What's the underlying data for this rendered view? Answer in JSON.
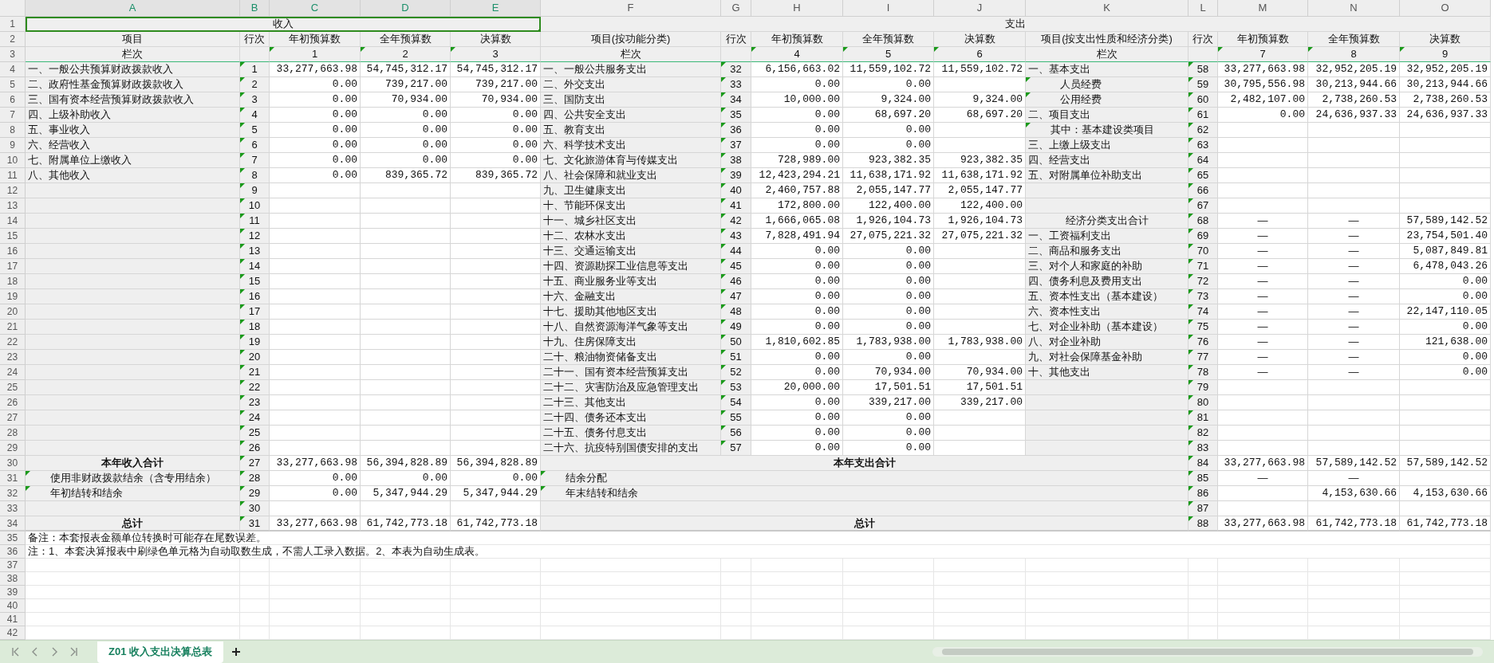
{
  "columns": [
    {
      "letter": "A",
      "selected": true
    },
    {
      "letter": "B",
      "selected": true
    },
    {
      "letter": "C",
      "selected": true
    },
    {
      "letter": "D",
      "selected": true
    },
    {
      "letter": "E",
      "selected": true
    },
    {
      "letter": "F",
      "selected": false
    },
    {
      "letter": "G",
      "selected": false
    },
    {
      "letter": "H",
      "selected": false
    },
    {
      "letter": "I",
      "selected": false
    },
    {
      "letter": "J",
      "selected": false
    },
    {
      "letter": "K",
      "selected": false
    },
    {
      "letter": "L",
      "selected": false
    },
    {
      "letter": "M",
      "selected": false
    },
    {
      "letter": "N",
      "selected": false
    },
    {
      "letter": "O",
      "selected": false
    }
  ],
  "rows": [
    {
      "number": "1",
      "kind": "title",
      "income": {
        "text": "收入",
        "selected": true
      },
      "expense": {
        "text": "支出",
        "selected": false
      }
    },
    {
      "number": "2",
      "kind": "header",
      "income": {
        "kind": "center",
        "cells": [
          "项目",
          "行次",
          "年初预算数",
          "全年预算数",
          "决算数"
        ],
        "flags": [
          false,
          false,
          false,
          false,
          false
        ]
      },
      "function": {
        "kind": "center",
        "cells": [
          "项目(按功能分类)",
          "行次",
          "年初预算数",
          "全年预算数",
          "决算数"
        ],
        "flags": [
          false,
          false,
          false,
          false,
          false
        ]
      },
      "economic": {
        "kind": "center",
        "cells": [
          "项目(按支出性质和经济分类)",
          "行次",
          "年初预算数",
          "全年预算数",
          "决算数"
        ],
        "flags": [
          false,
          false,
          false,
          false,
          false
        ]
      }
    },
    {
      "number": "3",
      "kind": "header",
      "income": {
        "kind": "center",
        "cells": [
          "栏次",
          null,
          "1",
          "2",
          "3"
        ],
        "flags": [
          false,
          false,
          true,
          true,
          true
        ]
      },
      "function": {
        "kind": "center",
        "cells": [
          "栏次",
          null,
          "4",
          "5",
          "6"
        ],
        "flags": [
          false,
          false,
          true,
          true,
          true
        ]
      },
      "economic": {
        "kind": "center",
        "cells": [
          "栏次",
          null,
          "7",
          "8",
          "9"
        ],
        "flags": [
          false,
          false,
          true,
          true,
          true
        ]
      }
    },
    {
      "number": "4",
      "kind": "body",
      "income": {
        "kind": "plain",
        "cells": [
          "一、一般公共预算财政拨款收入",
          "1",
          "33,277,663.98",
          "54,745,312.17",
          "54,745,312.17"
        ],
        "flags": [
          false,
          true,
          false,
          false,
          false
        ]
      },
      "function": {
        "kind": "plain",
        "cells": [
          "一、一般公共服务支出",
          "32",
          "6,156,663.02",
          "11,559,102.72",
          "11,559,102.72"
        ],
        "flags": [
          false,
          true,
          false,
          false,
          false
        ]
      },
      "economic": {
        "kind": "plain",
        "cells": [
          "一、基本支出",
          "58",
          "33,277,663.98",
          "32,952,205.19",
          "32,952,205.19"
        ],
        "flags": [
          false,
          true,
          false,
          false,
          false
        ]
      }
    },
    {
      "number": "5",
      "kind": "body",
      "income": {
        "kind": "plain",
        "cells": [
          "二、政府性基金预算财政拨款收入",
          "2",
          "0.00",
          "739,217.00",
          "739,217.00"
        ],
        "flags": [
          false,
          true,
          false,
          false,
          false
        ]
      },
      "function": {
        "kind": "plain",
        "cells": [
          "二、外交支出",
          "33",
          "0.00",
          "0.00",
          null
        ],
        "flags": [
          false,
          true,
          false,
          false,
          false
        ]
      },
      "economic": {
        "kind": "deep_indent",
        "cells": [
          "人员经费",
          "59",
          "30,795,556.98",
          "30,213,944.66",
          "30,213,944.66"
        ],
        "flags": [
          true,
          true,
          false,
          false,
          false
        ]
      }
    },
    {
      "number": "6",
      "kind": "body",
      "income": {
        "kind": "plain",
        "cells": [
          "三、国有资本经营预算财政拨款收入",
          "3",
          "0.00",
          "70,934.00",
          "70,934.00"
        ],
        "flags": [
          false,
          true,
          false,
          false,
          false
        ]
      },
      "function": {
        "kind": "plain",
        "cells": [
          "三、国防支出",
          "34",
          "10,000.00",
          "9,324.00",
          "9,324.00"
        ],
        "flags": [
          false,
          true,
          false,
          false,
          false
        ]
      },
      "economic": {
        "kind": "deep_indent",
        "cells": [
          "公用经费",
          "60",
          "2,482,107.00",
          "2,738,260.53",
          "2,738,260.53"
        ],
        "flags": [
          true,
          true,
          false,
          false,
          false
        ]
      }
    },
    {
      "number": "7",
      "kind": "body",
      "income": {
        "kind": "plain",
        "cells": [
          "四、上级补助收入",
          "4",
          "0.00",
          "0.00",
          "0.00"
        ],
        "flags": [
          false,
          true,
          false,
          false,
          false
        ]
      },
      "function": {
        "kind": "plain",
        "cells": [
          "四、公共安全支出",
          "35",
          "0.00",
          "68,697.20",
          "68,697.20"
        ],
        "flags": [
          false,
          true,
          false,
          false,
          false
        ]
      },
      "economic": {
        "kind": "plain",
        "cells": [
          "二、项目支出",
          "61",
          "0.00",
          "24,636,937.33",
          "24,636,937.33"
        ],
        "flags": [
          false,
          true,
          false,
          false,
          false
        ]
      }
    },
    {
      "number": "8",
      "kind": "body",
      "income": {
        "kind": "plain",
        "cells": [
          "五、事业收入",
          "5",
          "0.00",
          "0.00",
          "0.00"
        ],
        "flags": [
          false,
          true,
          false,
          false,
          false
        ]
      },
      "function": {
        "kind": "plain",
        "cells": [
          "五、教育支出",
          "36",
          "0.00",
          "0.00",
          null
        ],
        "flags": [
          false,
          true,
          false,
          false,
          false
        ]
      },
      "economic": {
        "kind": "indent",
        "cells": [
          "其中：基本建设类项目",
          "62",
          null,
          null,
          null
        ],
        "flags": [
          true,
          true,
          false,
          false,
          false
        ]
      }
    },
    {
      "number": "9",
      "kind": "body",
      "income": {
        "kind": "plain",
        "cells": [
          "六、经营收入",
          "6",
          "0.00",
          "0.00",
          "0.00"
        ],
        "flags": [
          false,
          true,
          false,
          false,
          false
        ]
      },
      "function": {
        "kind": "plain",
        "cells": [
          "六、科学技术支出",
          "37",
          "0.00",
          "0.00",
          null
        ],
        "flags": [
          false,
          true,
          false,
          false,
          false
        ]
      },
      "economic": {
        "kind": "plain",
        "cells": [
          "三、上缴上级支出",
          "63",
          null,
          null,
          null
        ],
        "flags": [
          false,
          true,
          false,
          false,
          false
        ]
      }
    },
    {
      "number": "10",
      "kind": "body",
      "income": {
        "kind": "plain",
        "cells": [
          "七、附属单位上缴收入",
          "7",
          "0.00",
          "0.00",
          "0.00"
        ],
        "flags": [
          false,
          true,
          false,
          false,
          false
        ]
      },
      "function": {
        "kind": "plain",
        "cells": [
          "七、文化旅游体育与传媒支出",
          "38",
          "728,989.00",
          "923,382.35",
          "923,382.35"
        ],
        "flags": [
          false,
          true,
          false,
          false,
          false
        ]
      },
      "economic": {
        "kind": "plain",
        "cells": [
          "四、经营支出",
          "64",
          null,
          null,
          null
        ],
        "flags": [
          false,
          true,
          false,
          false,
          false
        ]
      }
    },
    {
      "number": "11",
      "kind": "body",
      "income": {
        "kind": "plain",
        "cells": [
          "八、其他收入",
          "8",
          "0.00",
          "839,365.72",
          "839,365.72"
        ],
        "flags": [
          false,
          true,
          false,
          false,
          false
        ]
      },
      "function": {
        "kind": "plain",
        "cells": [
          "八、社会保障和就业支出",
          "39",
          "12,423,294.21",
          "11,638,171.92",
          "11,638,171.92"
        ],
        "flags": [
          false,
          true,
          false,
          false,
          false
        ]
      },
      "economic": {
        "kind": "plain",
        "cells": [
          "五、对附属单位补助支出",
          "65",
          null,
          null,
          null
        ],
        "flags": [
          false,
          true,
          false,
          false,
          false
        ]
      }
    },
    {
      "number": "12",
      "kind": "body",
      "income": {
        "kind": "plain",
        "cells": [
          null,
          "9",
          null,
          null,
          null
        ],
        "flags": [
          false,
          true,
          false,
          false,
          false
        ]
      },
      "function": {
        "kind": "plain",
        "cells": [
          "九、卫生健康支出",
          "40",
          "2,460,757.88",
          "2,055,147.77",
          "2,055,147.77"
        ],
        "flags": [
          false,
          true,
          false,
          false,
          false
        ]
      },
      "economic": {
        "kind": "plain",
        "cells": [
          null,
          "66",
          null,
          null,
          null
        ],
        "flags": [
          false,
          true,
          false,
          false,
          false
        ]
      }
    },
    {
      "number": "13",
      "kind": "body",
      "income": {
        "kind": "plain",
        "cells": [
          null,
          "10",
          null,
          null,
          null
        ],
        "flags": [
          false,
          true,
          false,
          false,
          false
        ]
      },
      "function": {
        "kind": "plain",
        "cells": [
          "十、节能环保支出",
          "41",
          "172,800.00",
          "122,400.00",
          "122,400.00"
        ],
        "flags": [
          false,
          true,
          false,
          false,
          false
        ]
      },
      "economic": {
        "kind": "plain",
        "cells": [
          null,
          "67",
          null,
          null,
          null
        ],
        "flags": [
          false,
          true,
          false,
          false,
          false
        ]
      }
    },
    {
      "number": "14",
      "kind": "body",
      "income": {
        "kind": "plain",
        "cells": [
          null,
          "11",
          null,
          null,
          null
        ],
        "flags": [
          false,
          true,
          false,
          false,
          false
        ]
      },
      "function": {
        "kind": "plain",
        "cells": [
          "十一、城乡社区支出",
          "42",
          "1,666,065.08",
          "1,926,104.73",
          "1,926,104.73"
        ],
        "flags": [
          false,
          true,
          false,
          false,
          false
        ]
      },
      "economic": {
        "kind": "center",
        "cells": [
          "经济分类支出合计",
          "68",
          "—",
          "—",
          "57,589,142.52"
        ],
        "flags": [
          false,
          true,
          false,
          false,
          false
        ],
        "not_applicable": [
          true,
          true,
          false
        ]
      }
    },
    {
      "number": "15",
      "kind": "body",
      "income": {
        "kind": "plain",
        "cells": [
          null,
          "12",
          null,
          null,
          null
        ],
        "flags": [
          false,
          true,
          false,
          false,
          false
        ]
      },
      "function": {
        "kind": "plain",
        "cells": [
          "十二、农林水支出",
          "43",
          "7,828,491.94",
          "27,075,221.32",
          "27,075,221.32"
        ],
        "flags": [
          false,
          true,
          false,
          false,
          false
        ]
      },
      "economic": {
        "kind": "plain",
        "cells": [
          "一、工资福利支出",
          "69",
          "—",
          "—",
          "23,754,501.40"
        ],
        "flags": [
          false,
          true,
          false,
          false,
          false
        ],
        "not_applicable": [
          true,
          true,
          false
        ]
      }
    },
    {
      "number": "16",
      "kind": "body",
      "income": {
        "kind": "plain",
        "cells": [
          null,
          "13",
          null,
          null,
          null
        ],
        "flags": [
          false,
          true,
          false,
          false,
          false
        ]
      },
      "function": {
        "kind": "plain",
        "cells": [
          "十三、交通运输支出",
          "44",
          "0.00",
          "0.00",
          null
        ],
        "flags": [
          false,
          true,
          false,
          false,
          false
        ]
      },
      "economic": {
        "kind": "plain",
        "cells": [
          "二、商品和服务支出",
          "70",
          "—",
          "—",
          "5,087,849.81"
        ],
        "flags": [
          false,
          true,
          false,
          false,
          false
        ],
        "not_applicable": [
          true,
          true,
          false
        ]
      }
    },
    {
      "number": "17",
      "kind": "body",
      "income": {
        "kind": "plain",
        "cells": [
          null,
          "14",
          null,
          null,
          null
        ],
        "flags": [
          false,
          true,
          false,
          false,
          false
        ]
      },
      "function": {
        "kind": "plain",
        "cells": [
          "十四、资源勘探工业信息等支出",
          "45",
          "0.00",
          "0.00",
          null
        ],
        "flags": [
          false,
          true,
          false,
          false,
          false
        ]
      },
      "economic": {
        "kind": "plain",
        "cells": [
          "三、对个人和家庭的补助",
          "71",
          "—",
          "—",
          "6,478,043.26"
        ],
        "flags": [
          false,
          true,
          false,
          false,
          false
        ],
        "not_applicable": [
          true,
          true,
          false
        ]
      }
    },
    {
      "number": "18",
      "kind": "body",
      "income": {
        "kind": "plain",
        "cells": [
          null,
          "15",
          null,
          null,
          null
        ],
        "flags": [
          false,
          true,
          false,
          false,
          false
        ]
      },
      "function": {
        "kind": "plain",
        "cells": [
          "十五、商业服务业等支出",
          "46",
          "0.00",
          "0.00",
          null
        ],
        "flags": [
          false,
          true,
          false,
          false,
          false
        ]
      },
      "economic": {
        "kind": "plain",
        "cells": [
          "四、债务利息及费用支出",
          "72",
          "—",
          "—",
          "0.00"
        ],
        "flags": [
          false,
          true,
          false,
          false,
          false
        ],
        "not_applicable": [
          true,
          true,
          false
        ]
      }
    },
    {
      "number": "19",
      "kind": "body",
      "income": {
        "kind": "plain",
        "cells": [
          null,
          "16",
          null,
          null,
          null
        ],
        "flags": [
          false,
          true,
          false,
          false,
          false
        ]
      },
      "function": {
        "kind": "plain",
        "cells": [
          "十六、金融支出",
          "47",
          "0.00",
          "0.00",
          null
        ],
        "flags": [
          false,
          true,
          false,
          false,
          false
        ]
      },
      "economic": {
        "kind": "plain",
        "cells": [
          "五、资本性支出（基本建设）",
          "73",
          "—",
          "—",
          "0.00"
        ],
        "flags": [
          false,
          true,
          false,
          false,
          false
        ],
        "not_applicable": [
          true,
          true,
          false
        ]
      }
    },
    {
      "number": "20",
      "kind": "body",
      "income": {
        "kind": "plain",
        "cells": [
          null,
          "17",
          null,
          null,
          null
        ],
        "flags": [
          false,
          true,
          false,
          false,
          false
        ]
      },
      "function": {
        "kind": "plain",
        "cells": [
          "十七、援助其他地区支出",
          "48",
          "0.00",
          "0.00",
          null
        ],
        "flags": [
          false,
          true,
          false,
          false,
          false
        ]
      },
      "economic": {
        "kind": "plain",
        "cells": [
          "六、资本性支出",
          "74",
          "—",
          "—",
          "22,147,110.05"
        ],
        "flags": [
          false,
          true,
          false,
          false,
          false
        ],
        "not_applicable": [
          true,
          true,
          false
        ]
      }
    },
    {
      "number": "21",
      "kind": "body",
      "income": {
        "kind": "plain",
        "cells": [
          null,
          "18",
          null,
          null,
          null
        ],
        "flags": [
          false,
          true,
          false,
          false,
          false
        ]
      },
      "function": {
        "kind": "plain",
        "cells": [
          "十八、自然资源海洋气象等支出",
          "49",
          "0.00",
          "0.00",
          null
        ],
        "flags": [
          false,
          true,
          false,
          false,
          false
        ]
      },
      "economic": {
        "kind": "plain",
        "cells": [
          "七、对企业补助（基本建设）",
          "75",
          "—",
          "—",
          "0.00"
        ],
        "flags": [
          false,
          true,
          false,
          false,
          false
        ],
        "not_applicable": [
          true,
          true,
          false
        ]
      }
    },
    {
      "number": "22",
      "kind": "body",
      "income": {
        "kind": "plain",
        "cells": [
          null,
          "19",
          null,
          null,
          null
        ],
        "flags": [
          false,
          true,
          false,
          false,
          false
        ]
      },
      "function": {
        "kind": "plain",
        "cells": [
          "十九、住房保障支出",
          "50",
          "1,810,602.85",
          "1,783,938.00",
          "1,783,938.00"
        ],
        "flags": [
          false,
          true,
          false,
          false,
          false
        ]
      },
      "economic": {
        "kind": "plain",
        "cells": [
          "八、对企业补助",
          "76",
          "—",
          "—",
          "121,638.00"
        ],
        "flags": [
          false,
          true,
          false,
          false,
          false
        ],
        "not_applicable": [
          true,
          true,
          false
        ]
      }
    },
    {
      "number": "23",
      "kind": "body",
      "income": {
        "kind": "plain",
        "cells": [
          null,
          "20",
          null,
          null,
          null
        ],
        "flags": [
          false,
          true,
          false,
          false,
          false
        ]
      },
      "function": {
        "kind": "plain",
        "cells": [
          "二十、粮油物资储备支出",
          "51",
          "0.00",
          "0.00",
          null
        ],
        "flags": [
          false,
          true,
          false,
          false,
          false
        ]
      },
      "economic": {
        "kind": "plain",
        "cells": [
          "九、对社会保障基金补助",
          "77",
          "—",
          "—",
          "0.00"
        ],
        "flags": [
          false,
          true,
          false,
          false,
          false
        ],
        "not_applicable": [
          true,
          true,
          false
        ]
      }
    },
    {
      "number": "24",
      "kind": "body",
      "income": {
        "kind": "plain",
        "cells": [
          null,
          "21",
          null,
          null,
          null
        ],
        "flags": [
          false,
          true,
          false,
          false,
          false
        ]
      },
      "function": {
        "kind": "plain",
        "cells": [
          "二十一、国有资本经营预算支出",
          "52",
          "0.00",
          "70,934.00",
          "70,934.00"
        ],
        "flags": [
          false,
          true,
          false,
          false,
          false
        ]
      },
      "economic": {
        "kind": "plain",
        "cells": [
          "十、其他支出",
          "78",
          "—",
          "—",
          "0.00"
        ],
        "flags": [
          false,
          true,
          false,
          false,
          false
        ],
        "not_applicable": [
          true,
          true,
          false
        ]
      }
    },
    {
      "number": "25",
      "kind": "body",
      "income": {
        "kind": "plain",
        "cells": [
          null,
          "22",
          null,
          null,
          null
        ],
        "flags": [
          false,
          true,
          false,
          false,
          false
        ]
      },
      "function": {
        "kind": "plain",
        "cells": [
          "二十二、灾害防治及应急管理支出",
          "53",
          "20,000.00",
          "17,501.51",
          "17,501.51"
        ],
        "flags": [
          false,
          true,
          false,
          false,
          false
        ]
      },
      "economic": {
        "kind": "plain",
        "cells": [
          null,
          "79",
          null,
          null,
          null
        ],
        "flags": [
          false,
          true,
          false,
          false,
          false
        ]
      }
    },
    {
      "number": "26",
      "kind": "body",
      "income": {
        "kind": "plain",
        "cells": [
          null,
          "23",
          null,
          null,
          null
        ],
        "flags": [
          false,
          true,
          false,
          false,
          false
        ]
      },
      "function": {
        "kind": "plain",
        "cells": [
          "二十三、其他支出",
          "54",
          "0.00",
          "339,217.00",
          "339,217.00"
        ],
        "flags": [
          false,
          true,
          false,
          false,
          false
        ]
      },
      "economic": {
        "kind": "plain",
        "cells": [
          null,
          "80",
          null,
          null,
          null
        ],
        "flags": [
          false,
          true,
          false,
          false,
          false
        ]
      }
    },
    {
      "number": "27",
      "kind": "body",
      "income": {
        "kind": "plain",
        "cells": [
          null,
          "24",
          null,
          null,
          null
        ],
        "flags": [
          false,
          true,
          false,
          false,
          false
        ]
      },
      "function": {
        "kind": "plain",
        "cells": [
          "二十四、债务还本支出",
          "55",
          "0.00",
          "0.00",
          null
        ],
        "flags": [
          false,
          true,
          false,
          false,
          false
        ]
      },
      "economic": {
        "kind": "plain",
        "cells": [
          null,
          "81",
          null,
          null,
          null
        ],
        "flags": [
          false,
          true,
          false,
          false,
          false
        ]
      }
    },
    {
      "number": "28",
      "kind": "body",
      "income": {
        "kind": "plain",
        "cells": [
          null,
          "25",
          null,
          null,
          null
        ],
        "flags": [
          false,
          true,
          false,
          false,
          false
        ]
      },
      "function": {
        "kind": "plain",
        "cells": [
          "二十五、债务付息支出",
          "56",
          "0.00",
          "0.00",
          null
        ],
        "flags": [
          false,
          true,
          false,
          false,
          false
        ]
      },
      "economic": {
        "kind": "plain",
        "cells": [
          null,
          "82",
          null,
          null,
          null
        ],
        "flags": [
          false,
          true,
          false,
          false,
          false
        ]
      }
    },
    {
      "number": "29",
      "kind": "body",
      "income": {
        "kind": "plain",
        "cells": [
          null,
          "26",
          null,
          null,
          null
        ],
        "flags": [
          false,
          true,
          false,
          false,
          false
        ]
      },
      "function": {
        "kind": "plain",
        "cells": [
          "二十六、抗疫特别国债安排的支出",
          "57",
          "0.00",
          "0.00",
          null
        ],
        "flags": [
          false,
          true,
          false,
          false,
          false
        ]
      },
      "economic": {
        "kind": "plain",
        "cells": [
          null,
          "83",
          null,
          null,
          null
        ],
        "flags": [
          false,
          true,
          false,
          false,
          false
        ]
      }
    },
    {
      "number": "30",
      "kind": "summary",
      "income": {
        "kind": "total",
        "cells": [
          "本年收入合计",
          "27",
          "33,277,663.98",
          "56,394,828.89",
          "56,394,828.89"
        ],
        "flags": [
          false,
          true,
          false,
          false,
          false
        ]
      },
      "expense_total": {
        "text": "本年支出合计",
        "kind": "total",
        "flagged": false
      },
      "economic": {
        "cells": [
          "84",
          "33,277,663.98",
          "57,589,142.52",
          "57,589,142.52"
        ],
        "flags": [
          true,
          false,
          false,
          false
        ]
      }
    },
    {
      "number": "31",
      "kind": "summary",
      "income": {
        "kind": "indent",
        "cells": [
          "使用非财政拨款结余（含专用结余）",
          "28",
          "0.00",
          "0.00",
          "0.00"
        ],
        "flags": [
          true,
          true,
          false,
          false,
          false
        ]
      },
      "expense_total": {
        "text": "结余分配",
        "kind": "indent",
        "flagged": true
      },
      "economic": {
        "cells": [
          "85",
          "—",
          "—",
          null
        ],
        "flags": [
          true,
          false,
          false,
          false
        ],
        "not_applicable": [
          true,
          true,
          false
        ]
      }
    },
    {
      "number": "32",
      "kind": "summary",
      "income": {
        "kind": "indent",
        "cells": [
          "年初结转和结余",
          "29",
          "0.00",
          "5,347,944.29",
          "5,347,944.29"
        ],
        "flags": [
          true,
          true,
          false,
          false,
          false
        ]
      },
      "expense_total": {
        "text": "年末结转和结余",
        "kind": "indent",
        "flagged": true
      },
      "economic": {
        "cells": [
          "86",
          null,
          "4,153,630.66",
          "4,153,630.66"
        ],
        "flags": [
          true,
          false,
          false,
          false
        ]
      }
    },
    {
      "number": "33",
      "kind": "summary",
      "income": {
        "kind": "plain",
        "cells": [
          null,
          "30",
          null,
          null,
          null
        ],
        "flags": [
          false,
          true,
          false,
          false,
          false
        ]
      },
      "economic": {
        "cells": [
          "87",
          null,
          null,
          null
        ],
        "flags": [
          true,
          false,
          false,
          false
        ]
      }
    },
    {
      "number": "34",
      "kind": "summary",
      "income": {
        "kind": "total",
        "cells": [
          "总计",
          "31",
          "33,277,663.98",
          "61,742,773.18",
          "61,742,773.18"
        ],
        "flags": [
          false,
          true,
          false,
          false,
          false
        ]
      },
      "expense_total": {
        "text": "总计",
        "kind": "total",
        "flagged": false
      },
      "economic": {
        "cells": [
          "88",
          "33,277,663.98",
          "61,742,773.18",
          "61,742,773.18"
        ],
        "flags": [
          true,
          false,
          false,
          false
        ]
      }
    },
    {
      "number": "35",
      "kind": "note",
      "text": "备注：本套报表金额单位转换时可能存在尾数误差。"
    },
    {
      "number": "36",
      "kind": "note",
      "text": "注：1、本套决算报表中刷绿色单元格为自动取数生成，不需人工录入数据。2、本表为自动生成表。"
    },
    {
      "number": "37",
      "kind": "blank"
    },
    {
      "number": "38",
      "kind": "blank"
    },
    {
      "number": "39",
      "kind": "blank"
    },
    {
      "number": "40",
      "kind": "blank"
    },
    {
      "number": "41",
      "kind": "blank"
    },
    {
      "number": "42",
      "kind": "blank"
    }
  ],
  "sheet_tabs": [
    {
      "label": "Z01 收入支出决算总表",
      "selected": true
    }
  ]
}
